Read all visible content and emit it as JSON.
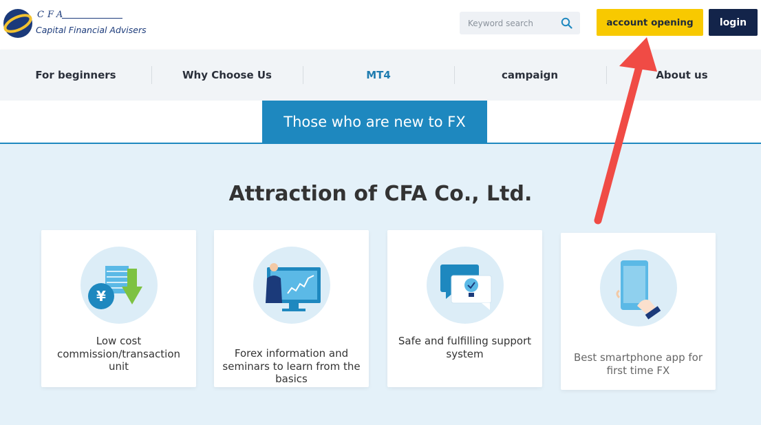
{
  "header": {
    "logo": {
      "abbr": "CFA",
      "name": "Capital Financial Advisers"
    },
    "search": {
      "placeholder": "Keyword search",
      "icon": "search-icon"
    },
    "account_opening_label": "account opening",
    "login_label": "login",
    "colors": {
      "accent": "#f8c900",
      "login_bg": "#13244a",
      "brand": "#1b3a7a"
    }
  },
  "nav": {
    "items": [
      {
        "label": "For beginners"
      },
      {
        "label": "Why Choose Us"
      },
      {
        "label": "MT4",
        "active": true
      },
      {
        "label": "campaign"
      },
      {
        "label": "About us"
      }
    ]
  },
  "tab": {
    "label": "Those who are new to FX",
    "color": "#1e88bf"
  },
  "main": {
    "title": "Attraction of CFA Co., Ltd.",
    "background": "#e4f1f9",
    "cards": [
      {
        "text": "Low cost commission/transaction unit",
        "icon": "yen-cost-down-icon"
      },
      {
        "text": "Forex information and seminars to learn from the basics",
        "icon": "seminar-presenter-icon"
      },
      {
        "text": "Safe and fulfilling support system",
        "icon": "support-chat-icon"
      },
      {
        "text": "Best smartphone app for first time FX",
        "icon": "smartphone-hand-icon"
      }
    ]
  },
  "annotation": {
    "type": "arrow",
    "color": "#f04b45",
    "points_to": "account opening"
  }
}
